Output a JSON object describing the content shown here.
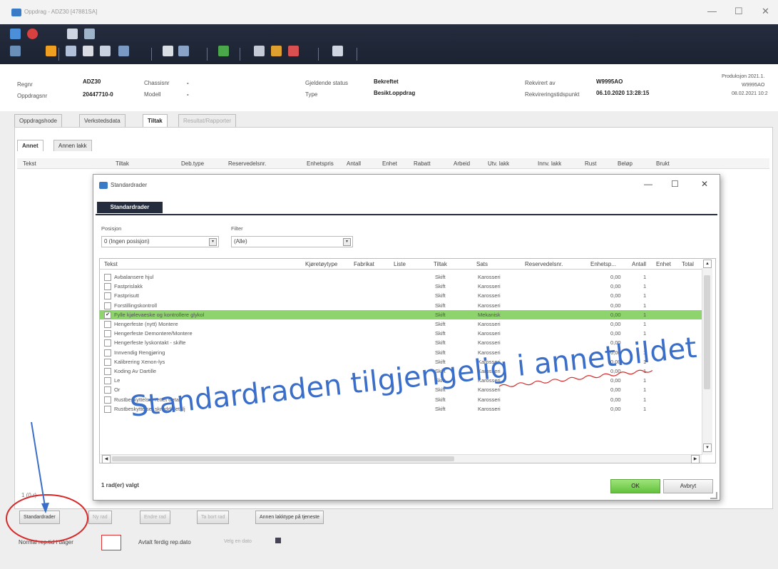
{
  "window": {
    "title": "Oppdrag - ADZ30 [47881SA]",
    "minimize": "—",
    "maximize": "☐",
    "close": "✕"
  },
  "info": {
    "regnr_label": "Regnr",
    "regnr_value": "ADZ30",
    "oppdragsnr_label": "Oppdragsnr",
    "oppdragsnr_value": "20447710-0",
    "chassisnr_label": "Chassisnr",
    "chassisnr_value": "-",
    "modell_label": "Modell",
    "modell_value": "-",
    "status_label": "Gjeldende status",
    "status_value": "Bekreftet",
    "type_label": "Type",
    "type_value": "Besikt.oppdrag",
    "rekvirert_label": "Rekvirert av",
    "rekvirert_value": "W9995AO",
    "rekvtid_label": "Rekvireringstidspunkt",
    "rekvtid_value": "06.10.2020 13:28:15",
    "prod_line1": "Produksjon 2021.1.",
    "prod_line2": "W9995AO",
    "prod_line3": "08.02.2021 10:2"
  },
  "tabs": [
    "Oppdragshode",
    "Verkstedsdata",
    "Tiltak",
    "Resultat/Rapporter"
  ],
  "subtabs": [
    "Annet",
    "Annen lakk"
  ],
  "grid_headers": [
    "Tekst",
    "Tiltak",
    "Deb.type",
    "Reservedelsnr.",
    "Enhetspris",
    "Antall",
    "Enhet",
    "Rabatt",
    "Arbeid",
    "Utv. lakk",
    "Innv. lakk",
    "Rust",
    "Beløp",
    "Brukt"
  ],
  "bottom": {
    "buttons": [
      "Standardrader",
      "Ny rad",
      "Endre rad",
      "Ta bort rad",
      "Annen lakktype på tjeneste"
    ],
    "rowcount": "1 (0 r)",
    "reg_label": "Normal rep.tid i dager",
    "ferdig_label": "Avtalt ferdig rep.dato",
    "date_placeholder": "Velg en dato"
  },
  "dialog": {
    "title": "Standardrader",
    "tab": "Standardrader",
    "posisjon_label": "Posisjon",
    "posisjon_value": "0 (Ingen posisjon)",
    "filter_label": "Filter",
    "filter_value": "(Alle)",
    "headers": [
      "Tekst",
      "Kjøretøytype",
      "Fabrikat",
      "Liste",
      "Tiltak",
      "Sats",
      "Reservedelsnr.",
      "Enhetsp...",
      "Antall",
      "Enhet",
      "Total"
    ],
    "rows": [
      {
        "tekst": "Avbalansere hjul",
        "tiltak": "Skift",
        "sats": "Karosseri",
        "pris": "0,00",
        "antall": "1",
        "checked": false
      },
      {
        "tekst": "Fastprislakk",
        "tiltak": "Skift",
        "sats": "Karosseri",
        "pris": "0,00",
        "antall": "1",
        "checked": false
      },
      {
        "tekst": "Fastprisutt",
        "tiltak": "Skift",
        "sats": "Karosseri",
        "pris": "0,00",
        "antall": "1",
        "checked": false
      },
      {
        "tekst": "Forstillingskontroll",
        "tiltak": "Skift",
        "sats": "Karosseri",
        "pris": "0,00",
        "antall": "1",
        "checked": false
      },
      {
        "tekst": "Fylle kjølevaeske og kontrollere glykol",
        "tiltak": "Skift",
        "sats": "Mekanisk",
        "pris": "0,00",
        "antall": "1",
        "checked": true
      },
      {
        "tekst": "Hengerfeste (nytt) Montere",
        "tiltak": "Skift",
        "sats": "Karosseri",
        "pris": "0,00",
        "antall": "1",
        "checked": false
      },
      {
        "tekst": "Hengerfeste Demontere/Montere",
        "tiltak": "Skift",
        "sats": "Karosseri",
        "pris": "0,00",
        "antall": "1",
        "checked": false
      },
      {
        "tekst": "Hengerfeste lyskontakt - skifte",
        "tiltak": "Skift",
        "sats": "Karosseri",
        "pris": "0,00",
        "antall": "1",
        "checked": false
      },
      {
        "tekst": "Innvendig Rengjøring",
        "tiltak": "Skift",
        "sats": "Karosseri",
        "pris": "0,00",
        "antall": "1",
        "checked": false
      },
      {
        "tekst": "Kalibrering Xenon-lys",
        "tiltak": "Skift",
        "sats": "Karosseri",
        "pris": "0,00",
        "antall": "1",
        "checked": false
      },
      {
        "tekst": "Koding Av Dartille",
        "tiltak": "Skift",
        "sats": "Karosseri",
        "pris": "0,00",
        "antall": "1",
        "checked": false
      },
      {
        "tekst": "Le",
        "tiltak": "Skift",
        "sats": "Karosseri",
        "pris": "0,00",
        "antall": "1",
        "checked": false
      },
      {
        "tekst": "Or",
        "tiltak": "Skift",
        "sats": "Karosseri",
        "pris": "0,00",
        "antall": "1",
        "checked": false
      },
      {
        "tekst": "Rustbeskyttelse, rettet detalj",
        "tiltak": "Skift",
        "sats": "Karosseri",
        "pris": "0,00",
        "antall": "1",
        "checked": false
      },
      {
        "tekst": "Rustbeskyttelse, skrudd detalj",
        "tiltak": "Skift",
        "sats": "Karosseri",
        "pris": "0,00",
        "antall": "1",
        "checked": false
      }
    ],
    "status": "1 rad(er) valgt",
    "ok": "OK",
    "cancel": "Avbryt"
  },
  "annotation": "Standardraden tilgjengelig i annetbildet",
  "colors": {
    "toolbar": "#242c3d",
    "selected_row": "#8ed46c",
    "annotation": "#3a6ec8",
    "circle": "#d62a2a"
  }
}
